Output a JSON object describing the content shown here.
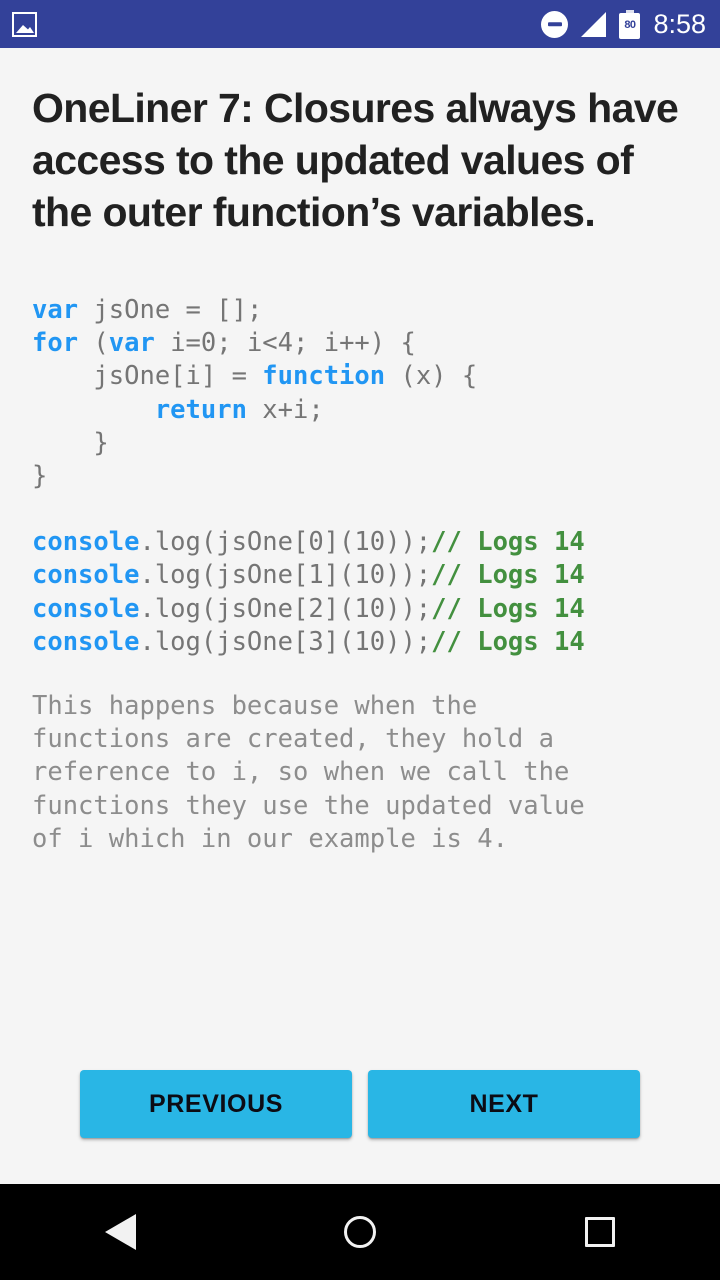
{
  "status_bar": {
    "background_color": "#334199",
    "notification_icon": "photo-icon",
    "dnd_icon": "do-not-disturb-icon",
    "signal_icon": "signal-icon",
    "battery_level": "80",
    "time": "8:58"
  },
  "article": {
    "title": "OneLiner 7: Closures always have access to the updated values of the outer function’s variables.",
    "code_lines": [
      [
        {
          "t": "var",
          "s": "kw"
        },
        {
          "t": " jsOne = [];",
          "s": "plain"
        }
      ],
      [
        {
          "t": "for",
          "s": "kw"
        },
        {
          "t": " (",
          "s": "plain"
        },
        {
          "t": "var",
          "s": "kw"
        },
        {
          "t": " i=0; i<4; i++) {",
          "s": "plain"
        }
      ],
      [
        {
          "t": "    jsOne[i] = ",
          "s": "plain"
        },
        {
          "t": "function",
          "s": "kw"
        },
        {
          "t": " (x) {",
          "s": "plain"
        }
      ],
      [
        {
          "t": "        ",
          "s": "plain"
        },
        {
          "t": "return",
          "s": "kw"
        },
        {
          "t": " x+i;",
          "s": "plain"
        }
      ],
      [
        {
          "t": "    }",
          "s": "plain"
        }
      ],
      [
        {
          "t": "}",
          "s": "plain"
        }
      ],
      [
        {
          "t": "",
          "s": "gap"
        }
      ],
      [
        {
          "t": "console",
          "s": "kw"
        },
        {
          "t": ".log(jsOne[0](10));",
          "s": "plain"
        },
        {
          "t": "// Logs 14",
          "s": "cmt"
        }
      ],
      [
        {
          "t": "console",
          "s": "kw"
        },
        {
          "t": ".log(jsOne[1](10));",
          "s": "plain"
        },
        {
          "t": "// Logs 14",
          "s": "cmt"
        }
      ],
      [
        {
          "t": "console",
          "s": "kw"
        },
        {
          "t": ".log(jsOne[2](10));",
          "s": "plain"
        },
        {
          "t": "// Logs 14",
          "s": "cmt"
        }
      ],
      [
        {
          "t": "console",
          "s": "kw"
        },
        {
          "t": ".log(jsOne[3](10));",
          "s": "plain"
        },
        {
          "t": "// Logs 14",
          "s": "cmt"
        }
      ]
    ],
    "explanation": "This happens because when the\nfunctions are created, they hold a\nreference to i, so when we call the\nfunctions they use the updated value\nof i which in our example is 4."
  },
  "footer": {
    "previous_label": "PREVIOUS",
    "next_label": "NEXT",
    "button_color": "#29b6e5"
  },
  "nav_bar": {
    "back_icon": "back-triangle-icon",
    "home_icon": "home-circle-icon",
    "recents_icon": "recents-square-icon"
  },
  "colors": {
    "keyword": "#2196f3",
    "comment": "#43903f",
    "code_text": "#757575",
    "page_background": "#f5f5f5"
  }
}
